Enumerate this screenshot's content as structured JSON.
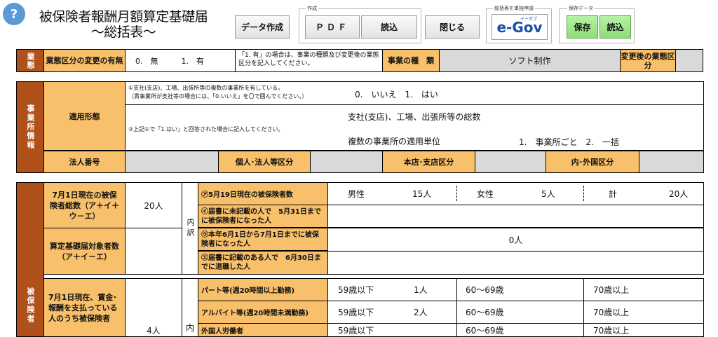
{
  "header": {
    "help": "?",
    "title_line1": "被保険者報酬月額算定基礎届",
    "title_line2": "～総括表～",
    "data_create": "データ作成",
    "create_group_label": "作成",
    "pdf": "ＰＤＦ",
    "read": "読込",
    "close": "閉じる",
    "egov_group_label": "総括表を単独申請",
    "egov": "e-Gov",
    "egov_small": "イーガブ",
    "save_group_label": "保存データ",
    "save": "保存",
    "load": "読込"
  },
  "industry": {
    "side": "業態",
    "change_label": "業態区分の変更の有無",
    "options": "0.　無　　　1.　有",
    "note": "「1. 有」の場合は、事業の種類及び変更後の業態区分を記入してください。",
    "business_type_label": "事業の種　類",
    "business_type_value": "ソフト制作",
    "changed_label": "変更後の業態区分"
  },
  "office": {
    "side": "事業所情報",
    "apply_label": "適用形態",
    "note1": "①支社(支店)、工場、出張所等の複数の事業所を有している。",
    "note1b": "（貴事業所が支社等の場合には、「0.いいえ」を〇で囲んでください。）",
    "note1_options": "0.　いいえ　1.　はい",
    "note2": "②上記①で「1.はい」と回答された場合に記入してください。",
    "total_label": "支社(支店)、工場、出張所等の総数",
    "unit_label": "複数の事業所の適用単位",
    "unit_options": "1.　事業所ごと　2.　一括",
    "corp_no": "法人番号",
    "indiv_corp": "個人･法人等区分",
    "hq_branch": "本店･支店区分",
    "domestic": "内･外国区分"
  },
  "insured": {
    "side": "被保険者",
    "total_label": "7月1日現在の被保険者総数（ア＋イ＋ウ－エ）",
    "total_value": "20人",
    "naiwake": "内訳",
    "a_label": "㋐5月19日現在の被保険者数",
    "male_label": "男性",
    "male_value": "15人",
    "female_label": "女性",
    "female_value": "5人",
    "sum_label": "計",
    "sum_value": "20人",
    "b_label": "㋑届書に未記載の人で　5月31日までに被保険者になった人",
    "target_label": "算定基礎届対象者数（ア＋イ－エ）",
    "c_label": "㋒本年6月1日から7月1日までに被保険者になった人",
    "c_value": "0人",
    "d_label": "㋓届書に記載のある人で　6月30日までに退職した人",
    "paid_label": "7月1日現在、賃金･報酬を支払っている人のうち被保険者",
    "paid_value": "4人",
    "naiwake2": "内",
    "part_label": "パート等(週20時間以上勤務)",
    "arbeit_label": "アルバイト等(週20時間未満勤務)",
    "foreign_label": "外国人労働者",
    "age1": "59歳以下",
    "age2": "60～69歳",
    "age3": "70歳以上",
    "part_v1": "1人",
    "arbeit_v1": "2人"
  }
}
